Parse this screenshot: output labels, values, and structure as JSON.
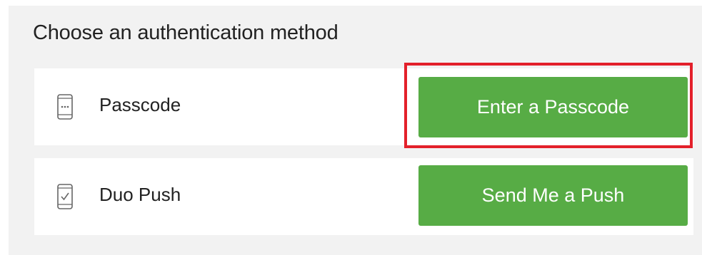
{
  "heading": "Choose an authentication method",
  "methods": [
    {
      "label": "Passcode",
      "icon": "passcode-phone-icon",
      "button_label": "Enter a Passcode"
    },
    {
      "label": "Duo Push",
      "icon": "push-phone-icon",
      "button_label": "Send Me a Push"
    }
  ],
  "colors": {
    "button_green": "#57ac45",
    "highlight_red": "#e3202a",
    "panel_background": "#f2f2f2"
  }
}
